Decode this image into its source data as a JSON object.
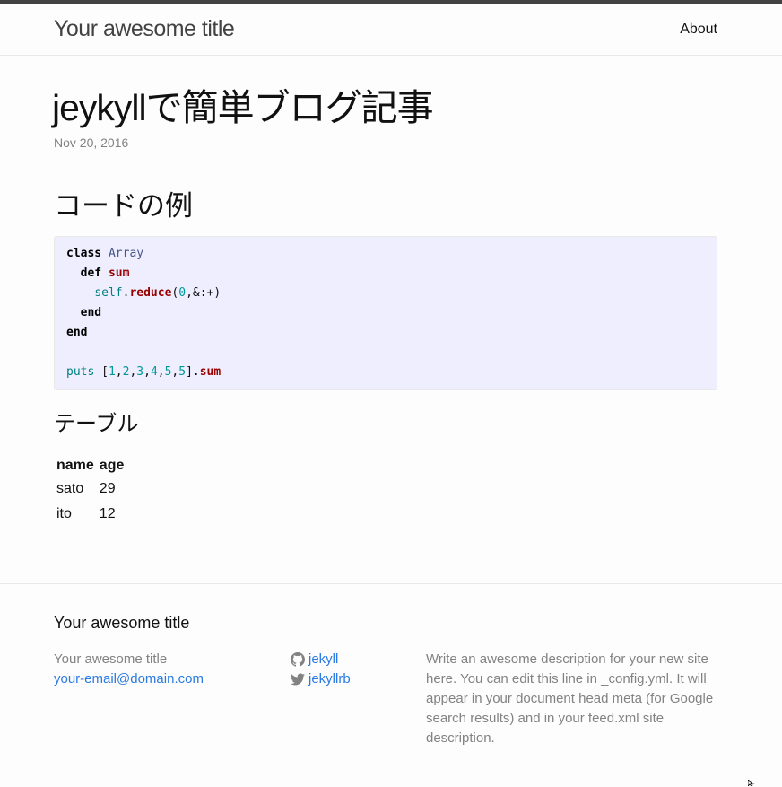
{
  "header": {
    "site_title": "Your awesome title",
    "nav_about": "About"
  },
  "post": {
    "title": "jeykyllで簡単ブログ記事",
    "date": "Nov 20, 2016"
  },
  "section_code": {
    "heading": "コードの例"
  },
  "code": {
    "line1": {
      "kw": "class",
      "cls": "Array"
    },
    "line2": {
      "kw": "def",
      "fn": "sum"
    },
    "line3": {
      "var": "self",
      "dot": ".",
      "fn": "reduce",
      "p1": "(",
      "num": "0",
      "rest": ",&:+)"
    },
    "line4": {
      "kw": "end"
    },
    "line5": {
      "kw": "end"
    },
    "line6": {
      "var": "puts",
      "open": "[",
      "n1": "1",
      "n2": "2",
      "n3": "3",
      "n4": "4",
      "n5": "5",
      "n6": "5",
      "close": "]",
      "dot": ".",
      "fn": "sum"
    }
  },
  "section_table": {
    "heading": "テーブル"
  },
  "table": {
    "headers": [
      "name",
      "age"
    ],
    "rows": [
      [
        "sato",
        "29"
      ],
      [
        "ito",
        "12"
      ]
    ]
  },
  "footer": {
    "heading": "Your awesome title",
    "col1": {
      "title": "Your awesome title",
      "email": "your-email@domain.com"
    },
    "col2": {
      "github": "jekyll",
      "twitter": "jekyllrb"
    },
    "description": "Write an awesome description for your new site here. You can edit this line in _config.yml. It will appear in your document head meta (for Google search results) and in your feed.xml site description."
  },
  "colors": {
    "link": "#2a7ae2",
    "code_bg": "#eeeeff",
    "topbar": "#424242",
    "muted": "#828282"
  },
  "icons": {
    "github": "github-icon",
    "twitter": "twitter-icon"
  }
}
